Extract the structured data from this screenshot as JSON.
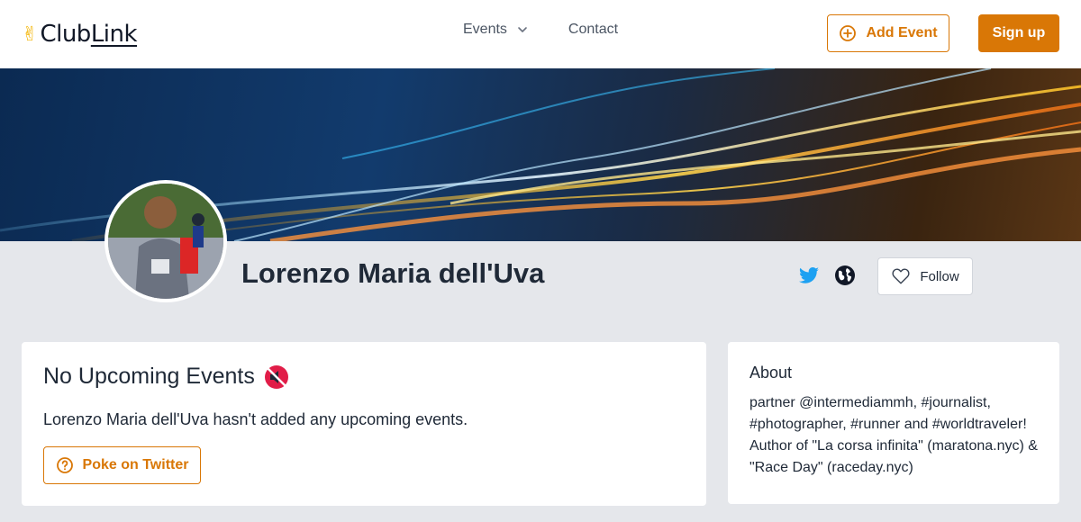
{
  "header": {
    "logo_text_a": "Club",
    "logo_text_b": "Link",
    "logo_icon": "victory-hand-icon",
    "nav": [
      {
        "label": "Events",
        "icon": "chevron-down-icon"
      },
      {
        "label": "Contact"
      }
    ],
    "add_event_label": "Add Event",
    "add_event_icon": "plus-circle-icon",
    "signup_label": "Sign up"
  },
  "profile": {
    "name": "Lorenzo Maria dell'Uva",
    "social_icons": [
      "twitter-icon",
      "globe-icon"
    ],
    "follow_label": "Follow",
    "follow_icon": "heart-outline-icon"
  },
  "events": {
    "title": "No Upcoming Events",
    "title_icon": "muted-speaker-icon",
    "message": "Lorenzo Maria dell'Uva hasn't added any upcoming events.",
    "poke_label": "Poke on Twitter",
    "poke_icon": "question-circle-icon"
  },
  "about": {
    "title": "About",
    "text": "partner @intermediammh, #journalist, #photographer, #runner and #worldtraveler! Author of \"La corsa infinita\" (maratona.nyc) & \"Race Day\" (raceday.nyc)"
  },
  "colors": {
    "accent": "#d97706",
    "background": "#e5e7eb",
    "twitter": "#1da1f2"
  }
}
